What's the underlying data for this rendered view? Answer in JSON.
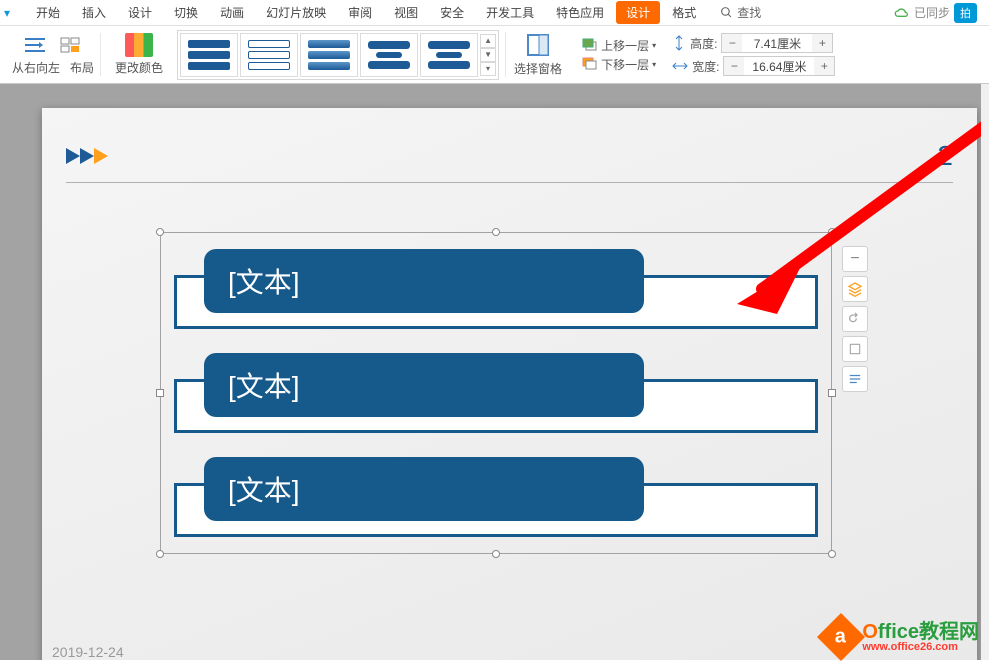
{
  "ribbon_tabs": {
    "start": "开始",
    "insert": "插入",
    "design": "设计",
    "transition": "切换",
    "animation": "动画",
    "slideshow": "幻灯片放映",
    "review": "审阅",
    "view": "视图",
    "security": "安全",
    "devtools": "开发工具",
    "special": "特色应用",
    "design2": "设计",
    "format": "格式",
    "search_placeholder": "查找"
  },
  "sync": {
    "label": "已同步",
    "badge": "拍"
  },
  "ribbon": {
    "rtl": "从右向左",
    "layout": "布局",
    "change_color": "更改颜色",
    "select_pane": "选择窗格",
    "bring_forward": "上移一层",
    "send_backward": "下移一层",
    "height_label": "高度:",
    "width_label": "宽度:",
    "height_value": "7.41厘米",
    "width_value": "16.64厘米"
  },
  "slide": {
    "page_number": "2",
    "smartart": {
      "item1": "[文本]",
      "item2": "[文本]",
      "item3": "[文本]"
    },
    "footer_date": "2019-12-24"
  },
  "watermark": {
    "brand_o": "O",
    "brand_rest": "ffice教程网",
    "url": "www.office26.com",
    "icon_glyph": "a"
  }
}
